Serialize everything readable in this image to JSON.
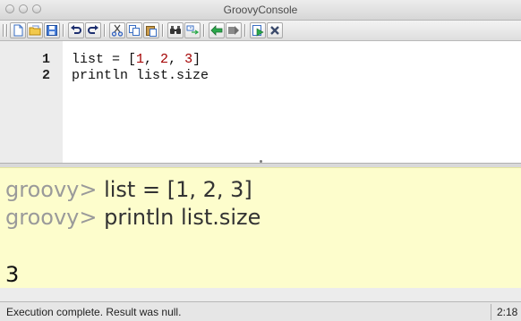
{
  "window": {
    "title": "GroovyConsole"
  },
  "toolbar": {
    "buttons": [
      {
        "icon": "new-file-icon"
      },
      {
        "icon": "open-folder-icon"
      },
      {
        "icon": "save-icon"
      },
      {
        "icon": "undo-icon"
      },
      {
        "icon": "redo-icon"
      },
      {
        "icon": "cut-icon"
      },
      {
        "icon": "copy-icon"
      },
      {
        "icon": "paste-icon"
      },
      {
        "icon": "find-icon"
      },
      {
        "icon": "replace-icon"
      },
      {
        "icon": "history-previous-icon"
      },
      {
        "icon": "history-next-icon"
      },
      {
        "icon": "run-script-icon"
      },
      {
        "icon": "clear-output-icon"
      }
    ]
  },
  "editor": {
    "lines": [
      {
        "number": "1",
        "pre": "list = [",
        "n1": "1",
        "sep1": ", ",
        "n2": "2",
        "sep2": ", ",
        "n3": "3",
        "post": "]"
      },
      {
        "number": "2",
        "text": "println list.size"
      }
    ]
  },
  "output": {
    "entries": [
      {
        "prompt": "groovy> ",
        "command": "list = [1, 2, 3]"
      },
      {
        "prompt": "groovy> ",
        "command": "println list.size"
      }
    ],
    "result": "3"
  },
  "status": {
    "message": "Execution complete. Result was null.",
    "position": "2:18"
  },
  "colors": {
    "output_background": "#fdfdcc",
    "number_literal": "#a30000",
    "prompt": "#9a9a9a"
  }
}
